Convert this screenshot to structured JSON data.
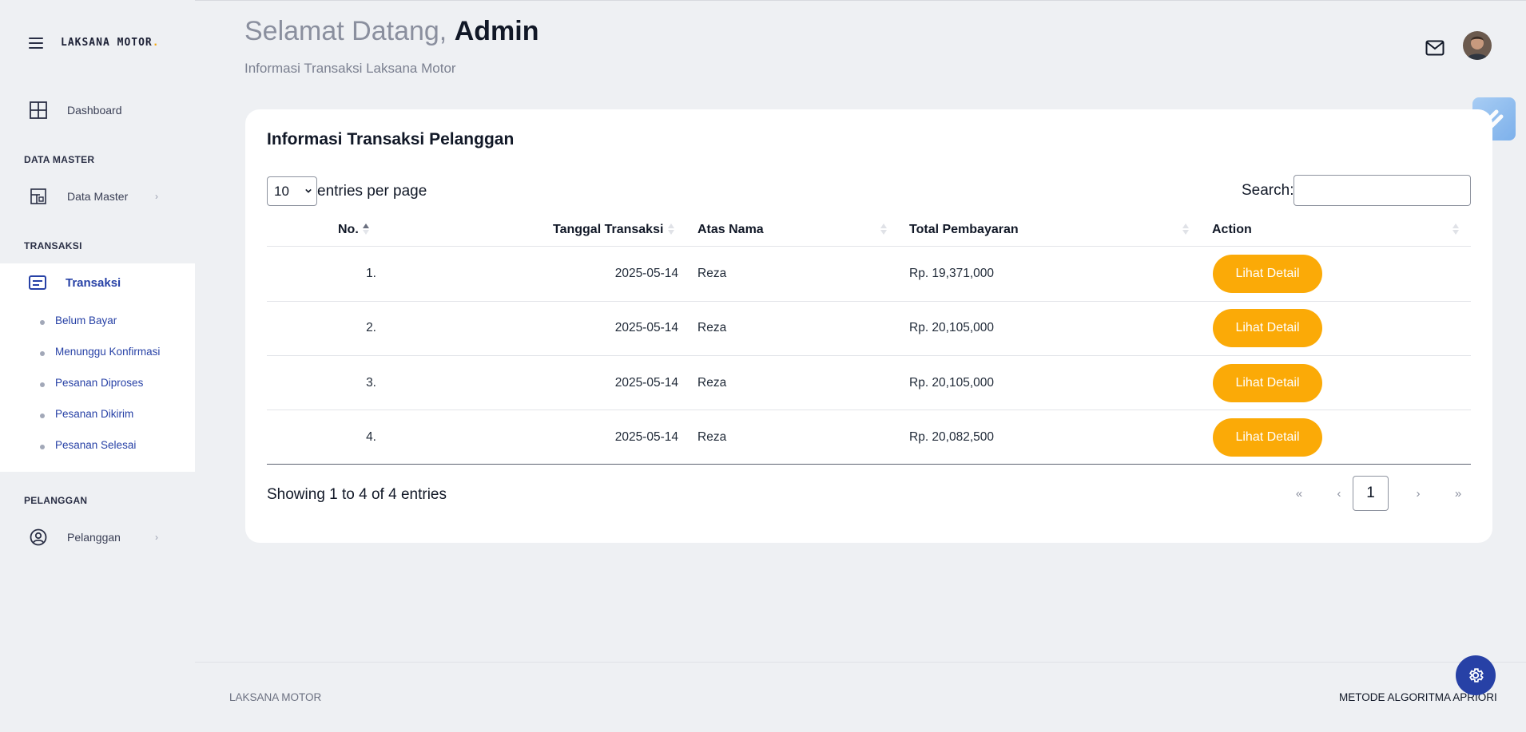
{
  "brand": {
    "name": "LAKSANA MOTOR",
    "dot": "."
  },
  "sidebar": {
    "dashboard_label": "Dashboard",
    "section_data_master": "DATA MASTER",
    "data_master_label": "Data Master",
    "section_transaksi": "TRANSAKSI",
    "transaksi_label": "Transaksi",
    "sub_items": [
      "Belum Bayar",
      "Menunggu Konfirmasi",
      "Pesanan Diproses",
      "Pesanan Dikirim",
      "Pesanan Selesai"
    ],
    "section_pelanggan": "PELANGGAN",
    "pelanggan_label": "Pelanggan",
    "chevron": "›"
  },
  "header": {
    "greeting": "Selamat Datang,",
    "user": "Admin",
    "subtitle": "Informasi Transaksi Laksana Motor"
  },
  "card": {
    "title": "Informasi Transaksi Pelanggan",
    "entries_value": "10",
    "entries_text": "entries per page",
    "search_label": "Search:",
    "search_value": "",
    "columns": [
      "No.",
      "Tanggal Transaksi",
      "Atas Nama",
      "Total Pembayaran",
      "Action"
    ],
    "rows": [
      {
        "no": "1.",
        "date": "2025-05-14",
        "name": "Reza",
        "total": "Rp. 19,371,000",
        "action": "Lihat Detail"
      },
      {
        "no": "2.",
        "date": "2025-05-14",
        "name": "Reza",
        "total": "Rp. 20,105,000",
        "action": "Lihat Detail"
      },
      {
        "no": "3.",
        "date": "2025-05-14",
        "name": "Reza",
        "total": "Rp. 20,105,000",
        "action": "Lihat Detail"
      },
      {
        "no": "4.",
        "date": "2025-05-14",
        "name": "Reza",
        "total": "Rp. 20,082,500",
        "action": "Lihat Detail"
      }
    ],
    "showing": "Showing 1 to 4 of 4 entries",
    "pager": {
      "first": "«",
      "prev": "‹",
      "current": "1",
      "next": "›",
      "last": "»"
    }
  },
  "footer": {
    "left": "LAKSANA MOTOR",
    "right": "METODE ALGORITMA APRIORI"
  },
  "colors": {
    "accent": "#2741a6",
    "button": "#fbaa07",
    "background": "#eef0f3"
  }
}
